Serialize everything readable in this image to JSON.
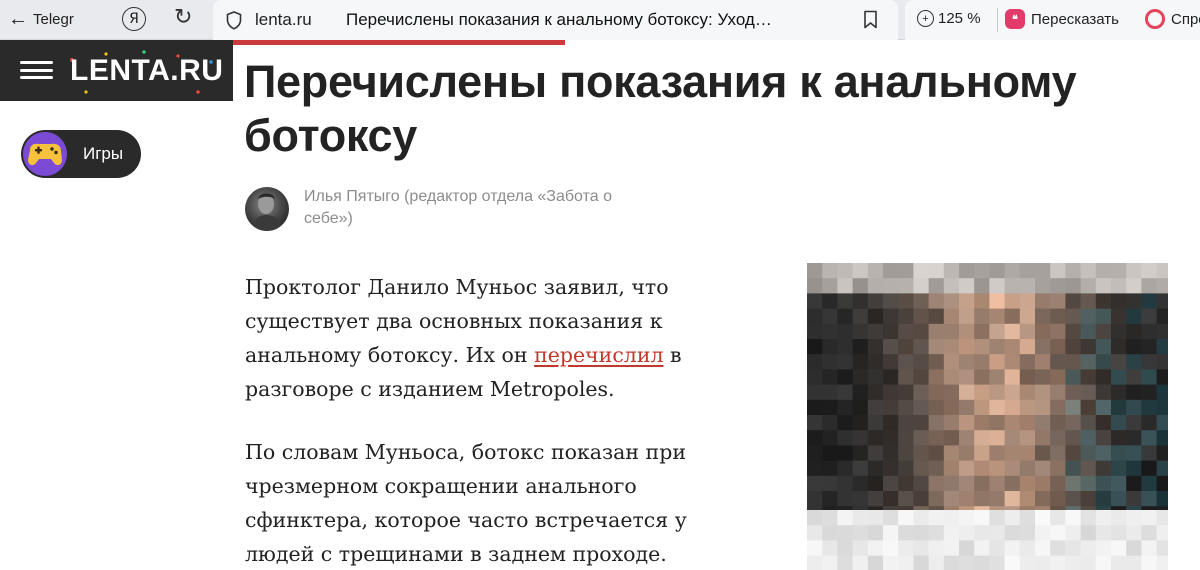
{
  "browser": {
    "back_label": "Telegr",
    "yandex_glyph": "Я",
    "domain": "lenta.ru",
    "page_title": "Перечислены показания к анальному ботоксу: Уход…",
    "zoom": "125 %",
    "retell_label": "Пересказать",
    "ask_label": "Спро",
    "icons": [
      "back-arrow-icon",
      "yandex-icon",
      "reload-icon",
      "shield-icon",
      "bookmark-icon",
      "zoom-icon",
      "retell-icon",
      "alice-icon"
    ]
  },
  "site": {
    "logo": "LENTA.RU",
    "games_label": "Игры"
  },
  "article": {
    "headline": "Перечислены показания к анальному ботоксу",
    "author": "Илья Пятыго (редактор отдела «Забота о себе»)",
    "lead_before": "Проктолог Данило Муньос заявил, что существует два основных показания к анальному ботоксу. Их он ",
    "lead_link": "перечислил",
    "lead_after": " в разговоре с изданием Metropoles.",
    "paragraph2": "По словам Муньоса, ботокс показан при чрезмерном сокращении анального сфинктера, которое часто встречается у людей с трещинами в заднем проходе."
  },
  "colors": {
    "header_bg": "#2a2a2a",
    "accent_red": "#cc3b3b",
    "link": "#c0392b",
    "author_gray": "#8c8c8c"
  }
}
